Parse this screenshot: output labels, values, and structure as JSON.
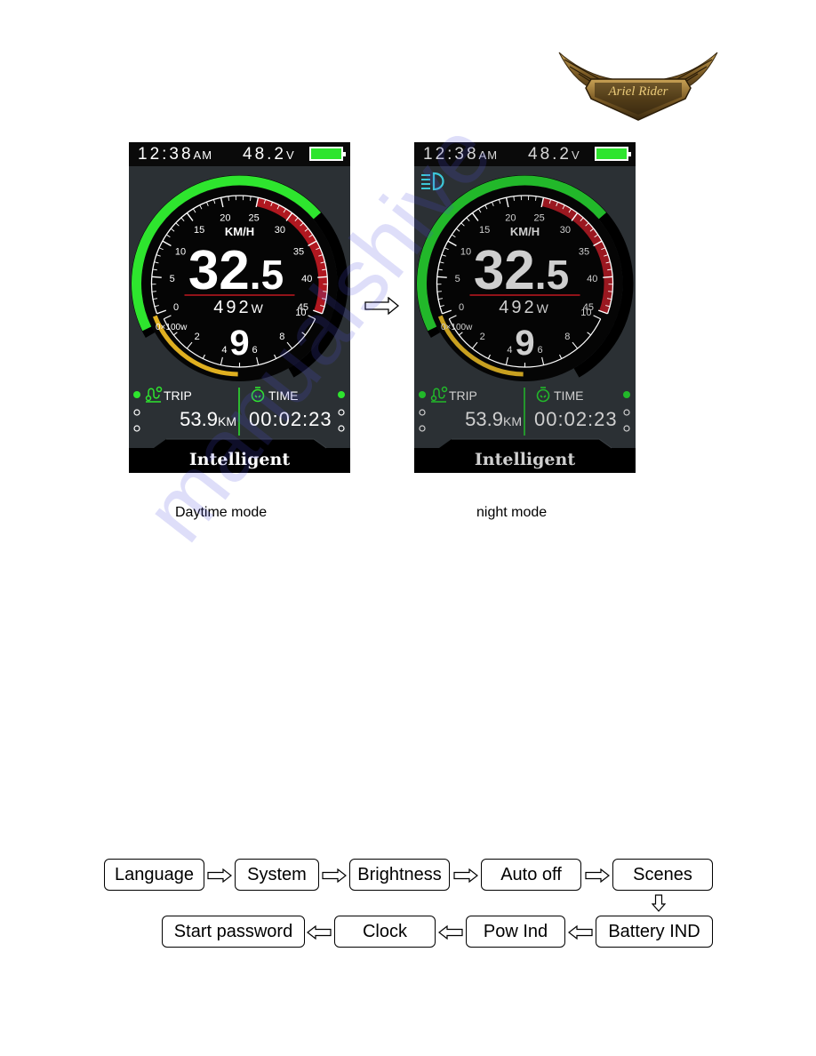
{
  "logo": {
    "text": "Ariel Rider",
    "icon": "winged-badge-logo"
  },
  "displays": [
    {
      "mode": "day",
      "caption": "Daytime mode",
      "time": "12:38",
      "time_suffix": "AM",
      "voltage": "48.2",
      "voltage_unit": "V",
      "battery_level": 1.0,
      "headlight_on": false,
      "speed_unit": "KM/H",
      "speed_int": "32",
      "speed_dec": ".5",
      "speed_value": 32.5,
      "speed_scale": [
        "0",
        "5",
        "10",
        "15",
        "20",
        "25",
        "30",
        "35",
        "40",
        "45"
      ],
      "speed_redline_start": 25,
      "power": "492",
      "power_unit": "W",
      "power_scale_label": "0×100w",
      "power_scale": [
        "2",
        "4",
        "6",
        "8",
        "10"
      ],
      "power_level": 4.92,
      "assist_level": "9",
      "trip_label": "TRIP",
      "trip_value": "53.9",
      "trip_unit": "KM",
      "time_label": "TIME",
      "ride_time": "00:02:23",
      "mode_name": "Intelligent",
      "colors": {
        "text": "#ffffff",
        "green": "#2ee52e",
        "red": "#b01820",
        "yellow": "#e0b020",
        "bg": "#2b3034"
      }
    },
    {
      "mode": "night",
      "caption": "night mode",
      "time": "12:38",
      "time_suffix": "AM",
      "voltage": "48.2",
      "voltage_unit": "V",
      "battery_level": 1.0,
      "headlight_on": true,
      "speed_unit": "KM/H",
      "speed_int": "32",
      "speed_dec": ".5",
      "speed_value": 32.5,
      "speed_scale": [
        "0",
        "5",
        "10",
        "15",
        "20",
        "25",
        "30",
        "35",
        "40",
        "45"
      ],
      "speed_redline_start": 25,
      "power": "492",
      "power_unit": "W",
      "power_scale_label": "0×100w",
      "power_scale": [
        "2",
        "4",
        "6",
        "8",
        "10"
      ],
      "power_level": 4.92,
      "assist_level": "9",
      "trip_label": "TRIP",
      "trip_value": "53.9",
      "trip_unit": "KM",
      "time_label": "TIME",
      "ride_time": "00:02:23",
      "mode_name": "Intelligent",
      "colors": {
        "text": "#cfcfcf",
        "green": "#22b82a",
        "red": "#9a1820",
        "yellow": "#c8a020",
        "bg": "#2b3034"
      }
    }
  ],
  "transition_arrow": "hollow-right-arrow",
  "flowchart": {
    "row1": [
      "Language",
      "System",
      "Brightness",
      "Auto off",
      "Scenes"
    ],
    "row2": [
      "Start password",
      "Clock",
      "Pow Ind",
      "Battery IND"
    ]
  },
  "watermark": "manualshive"
}
